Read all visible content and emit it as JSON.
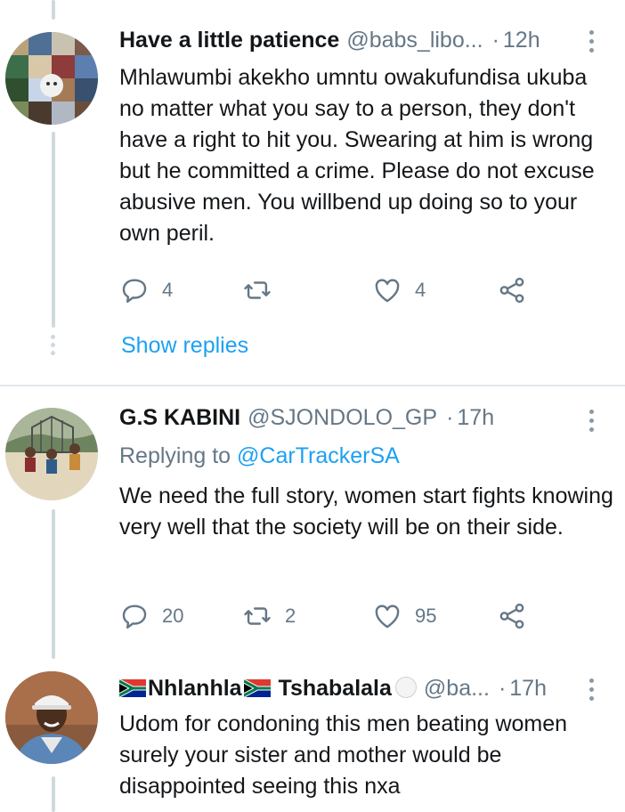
{
  "tweets": [
    {
      "name": "Have a little patience",
      "handle": "@babs_libo...",
      "separator": "·",
      "time": "12h",
      "text": "Mhlawumbi akekho umntu owakufundisa ukuba no matter what you say to a person, they don't have a right to hit you. Swearing at him is wrong but he committed a crime. Please do not excuse abusive men. You willbend up doing so to your own peril.",
      "replies": "4",
      "retweets": "",
      "likes": "4",
      "show_replies": "Show replies"
    },
    {
      "name": "G.S KABINI",
      "handle": "@SJONDOLO_GP",
      "separator": "·",
      "time": "17h",
      "replying_prefix": "Replying to",
      "replying_to": "@CarTrackerSA",
      "text": "We need the full story, women start fights knowing very well that the society will be on their side.",
      "replies": "20",
      "retweets": "2",
      "likes": "95"
    },
    {
      "name_part1": "Nhlanhla",
      "name_part2": "Tshabalala",
      "handle": "@ba...",
      "separator": "·",
      "time": "17h",
      "text": "Udom for condoning this men beating women surely your sister and mother would be disappointed seeing this nxa"
    }
  ],
  "icons": {
    "reply": "reply-icon",
    "retweet": "retweet-icon",
    "like": "heart-icon",
    "share": "share-icon",
    "more": "more-vertical-icon",
    "flag": "south-africa-flag-icon"
  },
  "colors": {
    "link": "#1da1f2",
    "secondary_text": "#657786",
    "thread_line": "#cfd9de"
  }
}
